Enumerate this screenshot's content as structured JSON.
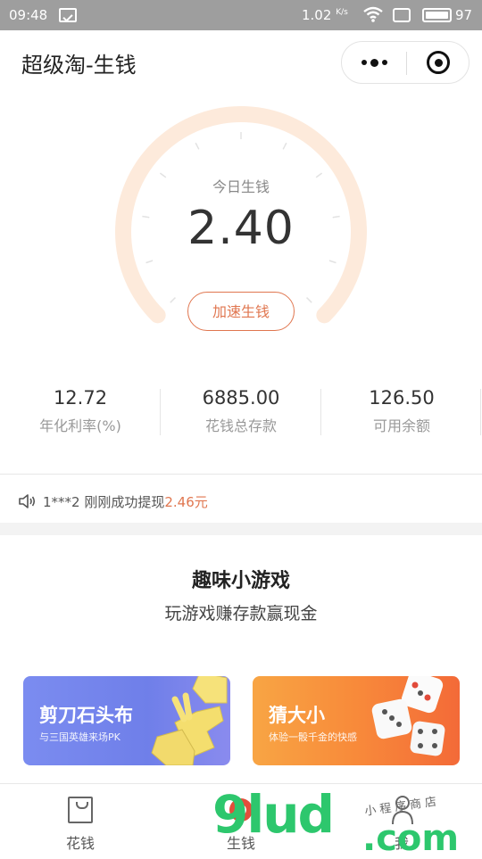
{
  "status_bar": {
    "time": "09:48",
    "speed_value": "1.02",
    "speed_unit": "K/s",
    "battery": "97"
  },
  "header": {
    "title": "超级淘-生钱"
  },
  "gauge": {
    "label": "今日生钱",
    "value": "2.40",
    "button_label": "加速生钱",
    "fraction": 0.0,
    "arc_color": "#fdeadb",
    "accent_color": "#e0764f"
  },
  "stats": [
    {
      "value": "12.72",
      "label": "年化利率(%)"
    },
    {
      "value": "6885.00",
      "label": "花钱总存款"
    },
    {
      "value": "126.50",
      "label": "可用余额"
    }
  ],
  "notice": {
    "text": "1***2 刚刚成功提现",
    "amount": "2.46元"
  },
  "games": {
    "title": "趣味小游戏",
    "subtitle": "玩游戏赚存款赢现金",
    "cards": [
      {
        "title": "剪刀石头布",
        "desc": "与三国英雄来场PK"
      },
      {
        "title": "猜大小",
        "desc": "体验一骰千金的快感"
      }
    ]
  },
  "tab_bar": {
    "tabs": [
      {
        "label": "花钱",
        "icon": "bag-icon"
      },
      {
        "label": "生钱",
        "icon": "coin-icon"
      },
      {
        "label": "我",
        "icon": "person-icon"
      }
    ]
  },
  "watermark": {
    "text": "9lud",
    "suffix": ".com",
    "small_text": "小程序商店"
  }
}
